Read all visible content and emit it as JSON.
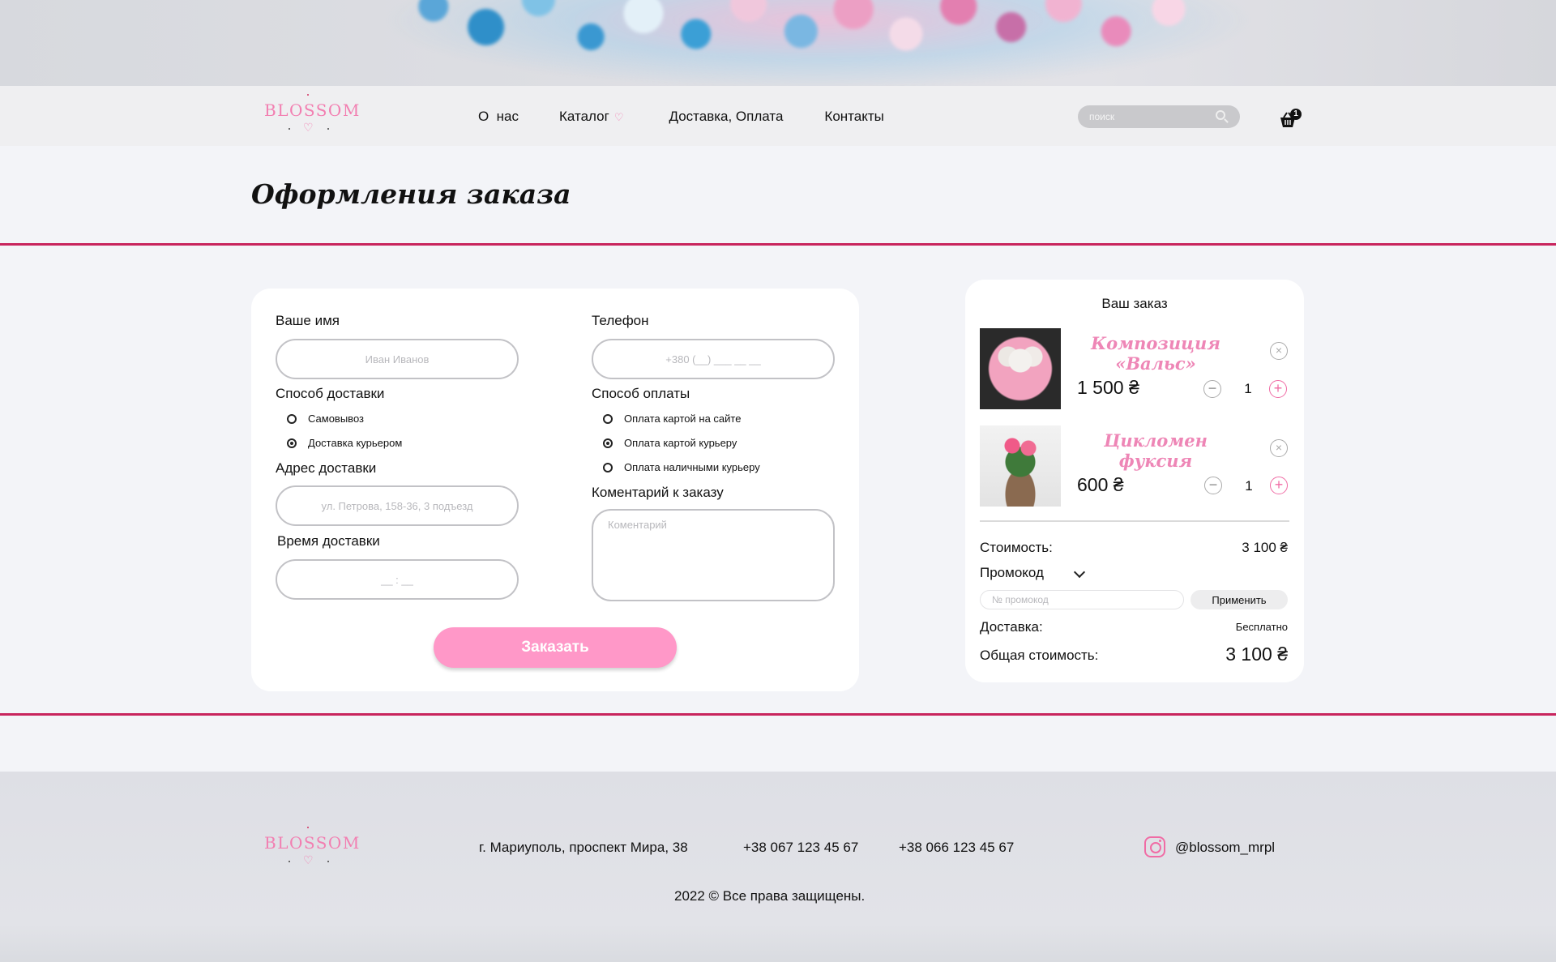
{
  "brand": {
    "name": "BLOSSOM",
    "accent": "#f27fb1",
    "divider_color": "#c8245d",
    "button_color": "#ff98c8"
  },
  "nav": {
    "about": "О  нас",
    "catalog": "Каталог",
    "delivery": "Доставка, Оплата",
    "contacts": "Контакты"
  },
  "search": {
    "placeholder": "поиск"
  },
  "cart": {
    "count": "1"
  },
  "page": {
    "title": "Оформления заказа"
  },
  "form": {
    "name_label": "Ваше имя",
    "name_placeholder": "Иван Иванов",
    "phone_label": "Телефон",
    "phone_placeholder": "+380 (__) ___ __ __",
    "delivery_method_label": "Способ доставки",
    "delivery_options": [
      "Самовывоз",
      "Доставка курьером"
    ],
    "delivery_selected": "Доставка курьером",
    "payment_method_label": "Способ оплаты",
    "payment_options": [
      "Оплата картой на сайте",
      "Оплата картой курьеру",
      "Оплата наличными курьеру"
    ],
    "payment_selected": "Оплата картой курьеру",
    "address_label": "Адрес доставки",
    "address_placeholder": "ул. Петрова, 158-36, 3 подъезд",
    "comment_label": "Коментарий к заказу",
    "comment_placeholder": "Коментарий",
    "time_label": "Время доставки",
    "time_placeholder": "__ : __",
    "submit_label": "Заказать"
  },
  "order": {
    "title": "Ваш заказ",
    "items": [
      {
        "name": "Композиция «Вальс»",
        "price": "1 500 ₴",
        "qty": "1"
      },
      {
        "name": "Цикломен фуксия",
        "price": "600 ₴",
        "qty": "1"
      }
    ],
    "cost_label": "Стоимость:",
    "cost_value": "3 100 ₴",
    "promo_label": "Промокод",
    "promo_placeholder": "№ промокод",
    "apply_label": "Применить",
    "delivery_label": "Доставка:",
    "delivery_value": "Бесплатно",
    "total_label": "Общая стоимость:",
    "total_value": "3 100 ₴"
  },
  "footer": {
    "address": "г. Мариуполь, проспект Мира, 38",
    "phone1": "+38 067 123 45 67",
    "phone2": "+38 066 123 45 67",
    "instagram": "@blossom_mrpl",
    "copyright": "2022 © Все права защищены."
  }
}
